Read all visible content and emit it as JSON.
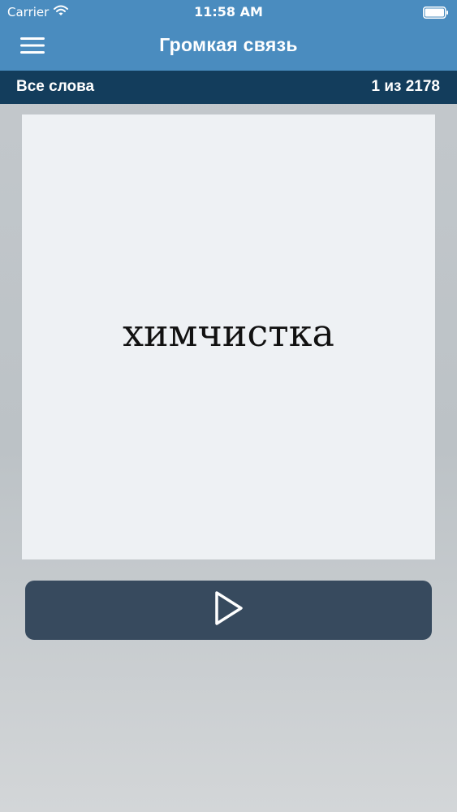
{
  "status_bar": {
    "carrier": "Carrier",
    "time": "11:58 AM",
    "wifi_icon": "wifi-icon",
    "battery_icon": "battery-icon"
  },
  "nav": {
    "menu_icon": "hamburger-menu-icon",
    "title": "Громкая связь"
  },
  "sub_bar": {
    "category": "Все слова",
    "progress": "1 из 2178"
  },
  "card": {
    "word": "химчистка"
  },
  "player": {
    "play_icon": "play-icon"
  },
  "colors": {
    "nav_bg": "#4a8cbf",
    "sub_bar_bg": "#133d5c",
    "card_bg": "#eef1f4",
    "play_button_bg": "#374a5e"
  }
}
